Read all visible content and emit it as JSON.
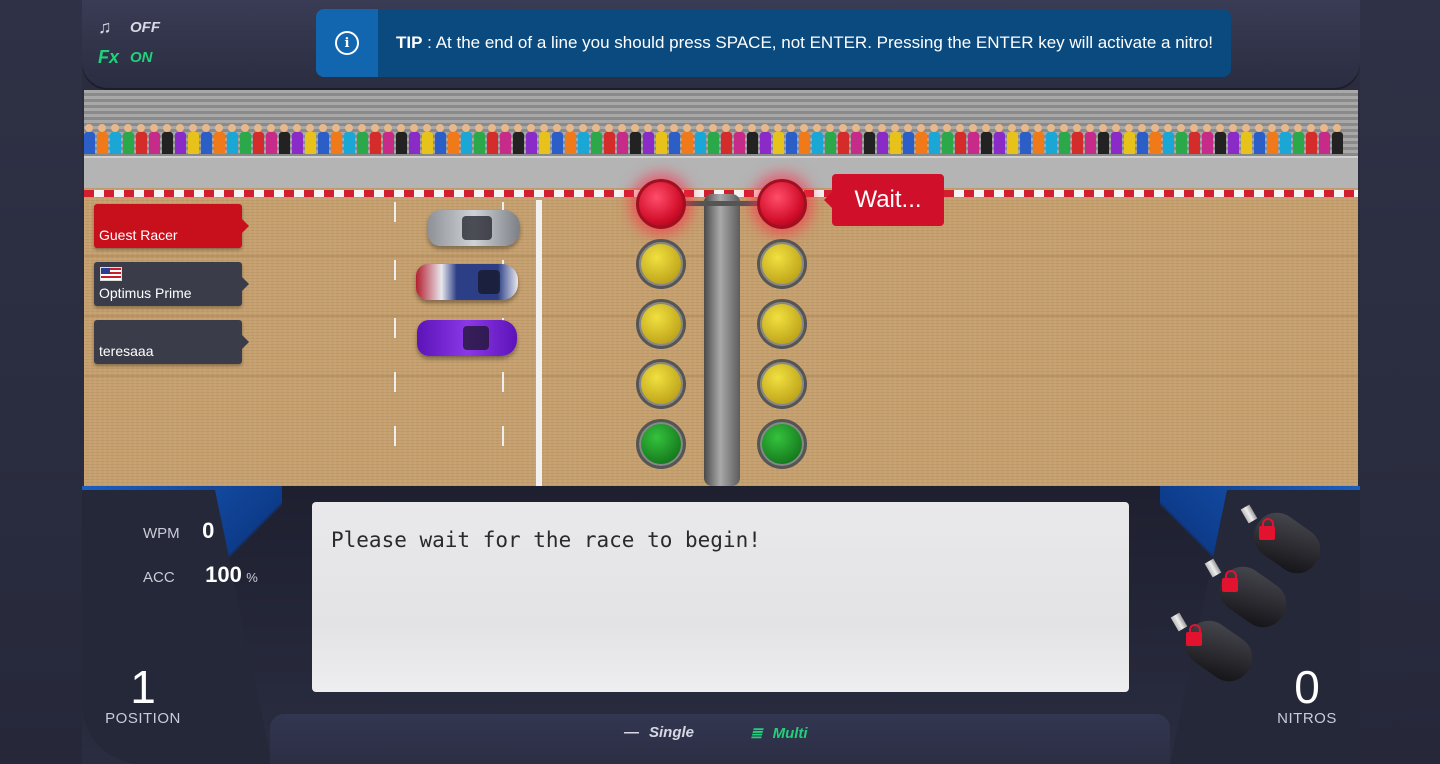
{
  "audio": {
    "music_icon": "music-note-icon",
    "music_state": "OFF",
    "fx_icon_text": "Fx",
    "fx_state": "ON"
  },
  "tip": {
    "icon": "info-icon",
    "title": "TIP",
    "separator": " : ",
    "message": "At the end of a line you should press SPACE, not ENTER. Pressing the ENTER key will activate a nitro!"
  },
  "racers": [
    {
      "name": "Guest Racer",
      "is_player": true,
      "flag": ""
    },
    {
      "name": "Optimus Prime",
      "is_player": false,
      "flag": "us-flag-icon"
    },
    {
      "name": "teresaaa",
      "is_player": false,
      "flag": ""
    }
  ],
  "status_bubble": "Wait...",
  "stats": {
    "wpm_label": "WPM",
    "wpm_value": "0",
    "acc_label": "ACC",
    "acc_value": "100",
    "acc_unit": "%"
  },
  "typing": {
    "text": "Please wait for the race to begin!"
  },
  "position": {
    "value": "1",
    "label": "POSITION"
  },
  "nitros": {
    "value": "0",
    "label": "NITROS",
    "locked_count": 3
  },
  "modes": {
    "single_icon": "dash-icon",
    "single_label": "Single",
    "multi_icon": "multi-lines-icon",
    "multi_label": "Multi"
  },
  "colors": {
    "player_label": "#c8101d",
    "fx_on": "#21d07a",
    "tip_bg": "#0b4a7f",
    "light_red": "#d3102c",
    "light_yellow": "#bfa51a",
    "light_green": "#157a1d"
  }
}
